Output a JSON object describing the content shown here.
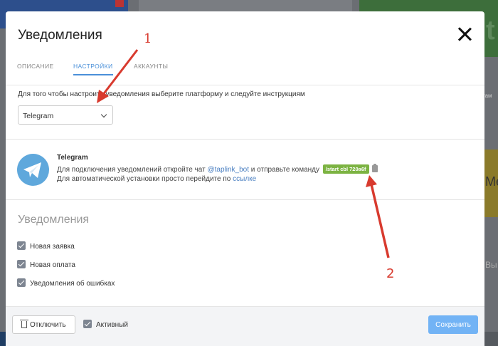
{
  "modal": {
    "title": "Уведомления",
    "tabs": [
      {
        "label": "ОПИСАНИЕ",
        "active": false
      },
      {
        "label": "НАСТРОЙКИ",
        "active": true
      },
      {
        "label": "АККАУНТЫ",
        "active": false
      }
    ],
    "instructions": "Для того чтобы настроить уведомления выберите платформу и следуйте инструкциям",
    "platform_select": {
      "value": "Telegram"
    },
    "telegram": {
      "name": "Telegram",
      "line1_prefix": "Для подключения уведомлений откройте чат ",
      "bot_link": "@taplink_bot",
      "line1_middle": " и отправьте команду",
      "command": "/start cbl      720a6f",
      "line2_prefix": "Для автоматической установки просто перейдите по ",
      "line2_link": "ссылке"
    },
    "notifications": {
      "title": "Уведомления",
      "items": [
        {
          "label": "Новая заявка",
          "checked": true
        },
        {
          "label": "Новая оплата",
          "checked": true
        },
        {
          "label": "Уведомления об ошибках",
          "checked": true
        }
      ]
    },
    "footer": {
      "disable_label": "Отключить",
      "active_label": "Активный",
      "active_checked": true,
      "save_label": "Сохранить"
    }
  },
  "annotations": {
    "label_1": "1",
    "label_2": "2",
    "color": "#d83a2e"
  },
  "background": {
    "right_snippet": "Me",
    "right_text": "Вы",
    "mid_text": "там"
  }
}
